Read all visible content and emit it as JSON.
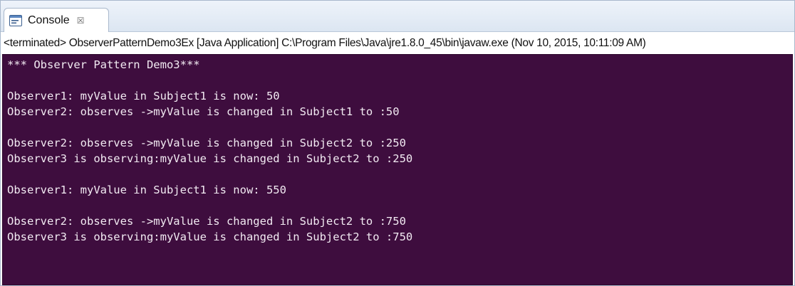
{
  "tab": {
    "icon": "console-icon",
    "label": "Console",
    "close_icon": "close-icon",
    "close_glyph": "☒"
  },
  "status": "<terminated> ObserverPatternDemo3Ex [Java Application] C:\\Program Files\\Java\\jre1.8.0_45\\bin\\javaw.exe (Nov 10, 2015, 10:11:09 AM)",
  "colors": {
    "console_background": "#3e0d3e",
    "console_text": "#f2eaf2"
  },
  "output_lines": [
    "*** Observer Pattern Demo3***",
    "",
    "Observer1: myValue in Subject1 is now: 50",
    "Observer2: observes ->myValue is changed in Subject1 to :50",
    "",
    "Observer2: observes ->myValue is changed in Subject2 to :250",
    "Observer3 is observing:myValue is changed in Subject2 to :250",
    "",
    "Observer1: myValue in Subject1 is now: 550",
    "",
    "Observer2: observes ->myValue is changed in Subject2 to :750",
    "Observer3 is observing:myValue is changed in Subject2 to :750"
  ]
}
